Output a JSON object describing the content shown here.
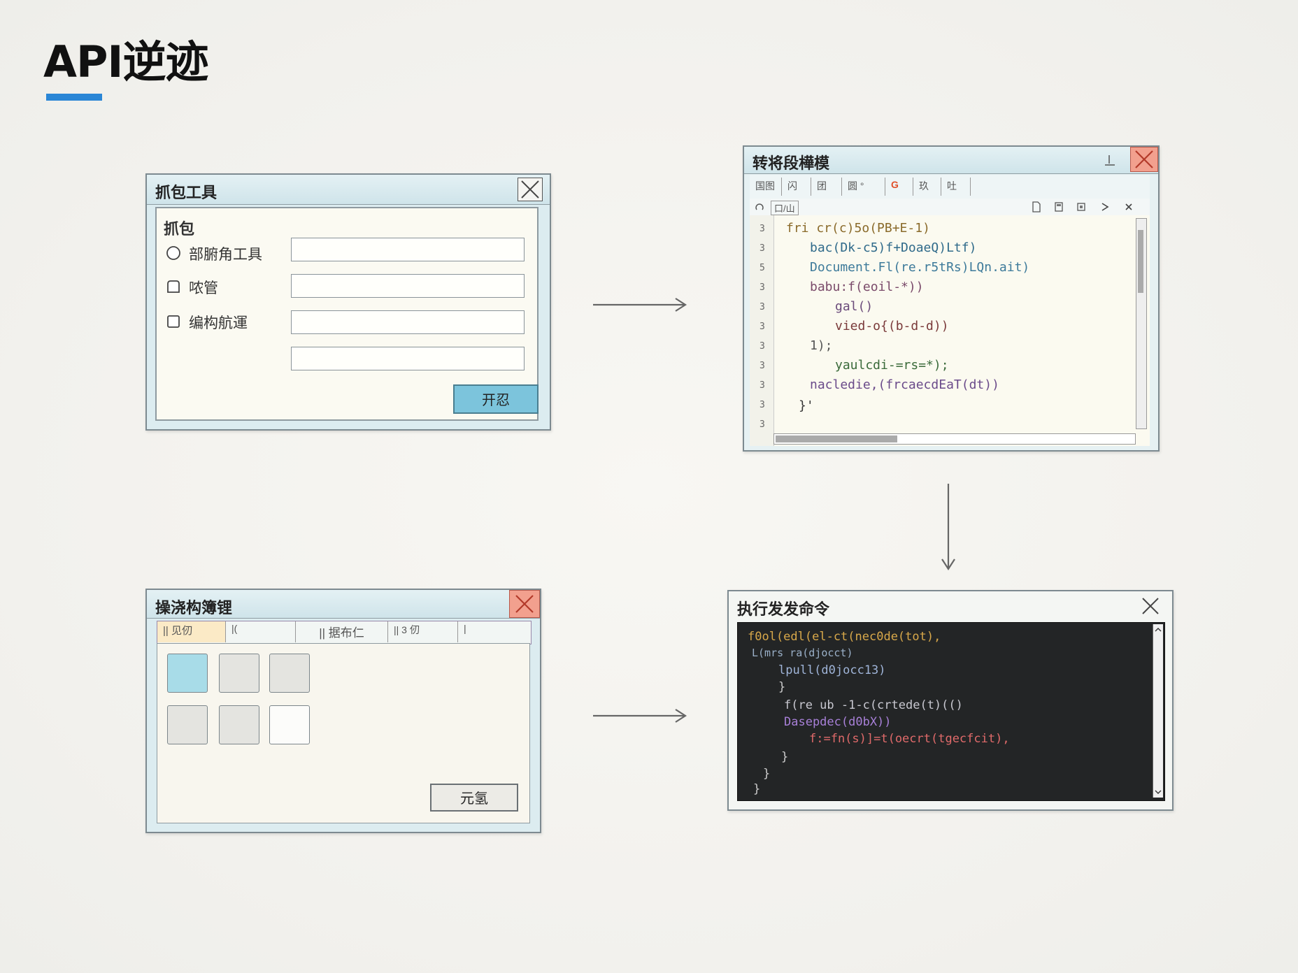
{
  "page": {
    "title": "API逆迹"
  },
  "capture_window": {
    "title": "抓包工具",
    "section_label": "抓包",
    "options": [
      {
        "label": "部腑角工具",
        "value": ""
      },
      {
        "label": "哝管",
        "value": ""
      },
      {
        "label": "编构航運",
        "value": ""
      }
    ],
    "extra_field_value": "",
    "button_label": "开忍"
  },
  "editor_window": {
    "title": "转将段樺模",
    "tabs": [
      "国图",
      "闪",
      "团",
      "圆 °",
      "G",
      "玖",
      "吐"
    ],
    "subtab": "口/山",
    "line_numbers": [
      "3",
      "3",
      "5",
      "3",
      "3",
      "3",
      "3",
      "3",
      "3",
      "3",
      "3"
    ],
    "code_lines": [
      "fri cr(c)5o(PB+E-1)",
      "bac(Dk-c5)f+DoaeQ)Ltf)",
      "Document.Fl(re.r5tRs)LQn.ait)",
      "babu:f(eoil-*))",
      "gal()",
      "vied-o{(b-d-d))",
      "1);",
      "yaulcdi-=rs=*);",
      "nacledie,(frcaecdEaT(dt))",
      "}'"
    ]
  },
  "transfer_window": {
    "title": "操浇构簿锂",
    "tabs": [
      "|| 见仞",
      "|(",
      "|| 据布仁",
      "|| 3 仞",
      "|"
    ],
    "button_label": "元氢"
  },
  "terminal_window": {
    "title": "执行发发命令",
    "lines": [
      "f0ol(edl(el-ct(nec0de(tot),",
      "L(mrs ra(djocct)",
      "lpull(d0jocc13)",
      "}",
      "f(re ub -1-c(crtede(t)(()",
      "Dasepdec(d0bX))",
      "f:=fn(s)]=t(oecrt(tgecfcit),",
      "}",
      "}",
      "}"
    ]
  },
  "colors": {
    "accent": "#2a86d6",
    "window_chrome": "#dcecf0",
    "primary_button": "#7cc4dc",
    "close_red": "#f2a08e",
    "terminal_bg": "#232526"
  }
}
